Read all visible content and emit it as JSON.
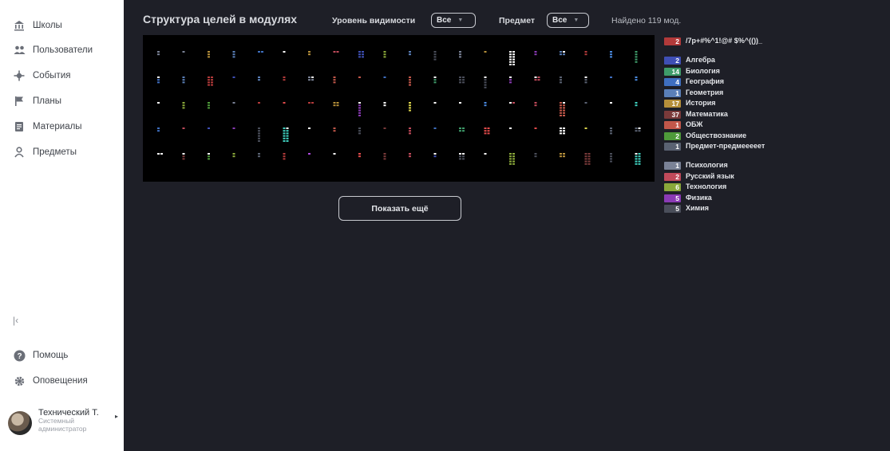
{
  "sidebar": {
    "nav": [
      {
        "label": "Школы",
        "icon": "school-icon"
      },
      {
        "label": "Пользователи",
        "icon": "users-icon"
      },
      {
        "label": "События",
        "icon": "events-icon"
      },
      {
        "label": "Планы",
        "icon": "flag-icon"
      },
      {
        "label": "Материалы",
        "icon": "materials-icon"
      },
      {
        "label": "Предметы",
        "icon": "subjects-icon"
      }
    ],
    "collapse_glyph": "|‹",
    "bottom": [
      {
        "label": "Помощь",
        "icon": "help-icon"
      },
      {
        "label": "Оповещения",
        "icon": "gear-icon"
      }
    ],
    "profile": {
      "name": "Технический Т.",
      "role": "Системный администратор"
    }
  },
  "header": {
    "title": "Структура целей в модулях",
    "visibility_label": "Уровень видимости",
    "visibility_value": "Все",
    "subject_label": "Предмет",
    "subject_value": "Все",
    "found_text": "Найдено 119 мод."
  },
  "legend": [
    {
      "count": "2",
      "name": "/7p+#%^1!@# $%^(())_",
      "color": "#b23a3a"
    },
    {
      "count": "2",
      "name": "Алгебра",
      "color": "#3f4fb5"
    },
    {
      "count": "14",
      "name": "Биология",
      "color": "#3f9c6a"
    },
    {
      "count": "4",
      "name": "География",
      "color": "#3f6fc0"
    },
    {
      "count": "1",
      "name": "Геометрия",
      "color": "#5a7fb8"
    },
    {
      "count": "17",
      "name": "История",
      "color": "#b58f3a"
    },
    {
      "count": "37",
      "name": "Математика",
      "color": "#7a3a3a"
    },
    {
      "count": "1",
      "name": "ОБЖ",
      "color": "#c2574a"
    },
    {
      "count": "2",
      "name": "Обществознание",
      "color": "#4e9a3a"
    },
    {
      "count": "1",
      "name": "Предмет-предмееееет",
      "color": "#5a6272"
    },
    {
      "count": "1",
      "name": "Психология",
      "color": "#7a8296"
    },
    {
      "count": "2",
      "name": "Русский язык",
      "color": "#c04a5a"
    },
    {
      "count": "6",
      "name": "Технология",
      "color": "#8aa83a"
    },
    {
      "count": "5",
      "name": "Физика",
      "color": "#8a3ab5"
    },
    {
      "count": "5",
      "name": "Химия",
      "color": "#4a4e5a"
    }
  ],
  "show_more_label": "Показать ещё"
}
